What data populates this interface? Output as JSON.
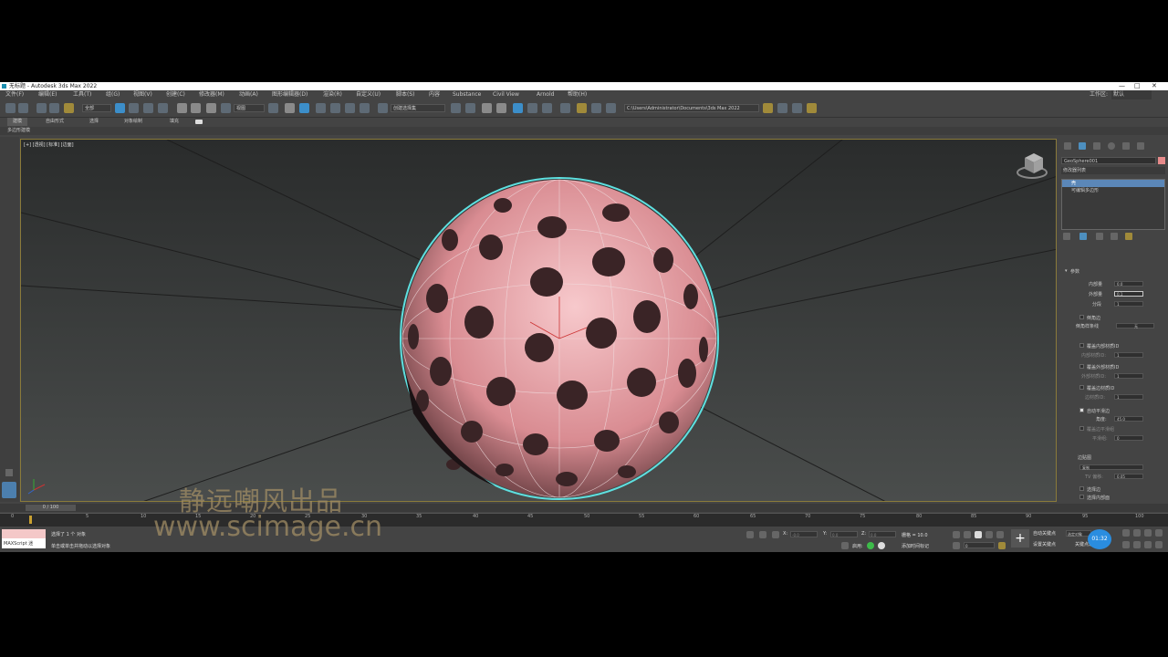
{
  "window": {
    "title": "无标题 - Autodesk 3ds Max 2022"
  },
  "menu": [
    "文件(F)",
    "编辑(E)",
    "工具(T)",
    "组(G)",
    "视图(V)",
    "创建(C)",
    "修改器(M)",
    "动画(A)",
    "图形编辑器(D)",
    "渲染(R)",
    "自定义(U)",
    "脚本(S)",
    "内容",
    "Substance",
    "Civil View",
    "Arnold",
    "帮助(H)"
  ],
  "workspace": {
    "label": "工作区:",
    "value": "默认"
  },
  "toolbar": {
    "filter_value": "全部",
    "ref_coord": "视图",
    "selection_set": "创建选择集",
    "project_path": "C:\\Users\\Administrator\\Documents\\3ds Max 2022"
  },
  "ribbon": {
    "tabs": [
      "建模",
      "自由形式",
      "选择",
      "对象绘制",
      "填充"
    ],
    "sub": "多边形建模"
  },
  "viewport": {
    "label": "[+] [透视] [标准] [边面]"
  },
  "command_panel": {
    "object_name": "GeoSphere001",
    "object_color": "#e68a8a",
    "modifier_list": "修改器列表",
    "stack": [
      "壳",
      "可编辑多边形"
    ],
    "section_title": "参数",
    "params": {
      "inner_amount_label": "内部量",
      "inner_amount": "0.0",
      "outer_amount_label": "外部量",
      "outer_amount": "0.1",
      "segments_label": "分段",
      "segments": "1",
      "bevel_edges": "倒角边",
      "bevel_spline_label": "倒角样条线",
      "bevel_spline_value": "无",
      "override_inner_mat": "覆盖内部材质ID",
      "inner_mat_label": "内部材质ID:",
      "inner_mat": "1",
      "override_outer_mat": "覆盖外部材质ID",
      "outer_mat_label": "外部材质ID:",
      "outer_mat": "1",
      "override_edge_mat": "覆盖边材质ID",
      "edge_mat_label": "边材质ID:",
      "edge_mat": "1",
      "auto_smooth": "自动平滑边",
      "angle_label": "角度:",
      "angle": "45.0",
      "override_smooth": "覆盖边平滑组",
      "smooth_group_label": "平滑组:",
      "smooth_group": "0",
      "edge_map_label": "边贴图",
      "edge_map_value": "复制",
      "tv_offset_label": "TV 偏移:",
      "tv_offset": "0.05",
      "select_edges": "选择边",
      "select_inner": "选择内部面"
    }
  },
  "timeline": {
    "frame": "0 / 100",
    "ticks": [
      "0",
      "5",
      "10",
      "15",
      "20",
      "25",
      "30",
      "35",
      "40",
      "45",
      "50",
      "55",
      "60",
      "65",
      "70",
      "75",
      "80",
      "85",
      "90",
      "95",
      "100"
    ]
  },
  "status": {
    "maxscript": "MAXScript 迷",
    "selected": "选择了 1 个 对象",
    "hint": "单击或单击并拖动以选择对象",
    "x_label": "X:",
    "x": "-0.0",
    "y_label": "Y:",
    "y": "0.0",
    "z_label": "Z:",
    "z": "0.0",
    "grid": "栅格 = 10.0",
    "enabled": "启用:",
    "add_time_tag": "添加时间标记",
    "frame_field": "0",
    "auto_key": "自动关键点",
    "selected_obj": "选定对象",
    "set_key": "设置关键点",
    "key_filters": "关键点过滤器...",
    "timer": "01:32"
  },
  "watermark": {
    "line1": "静远嘲风出品",
    "line2": "www.scimage.cn"
  }
}
